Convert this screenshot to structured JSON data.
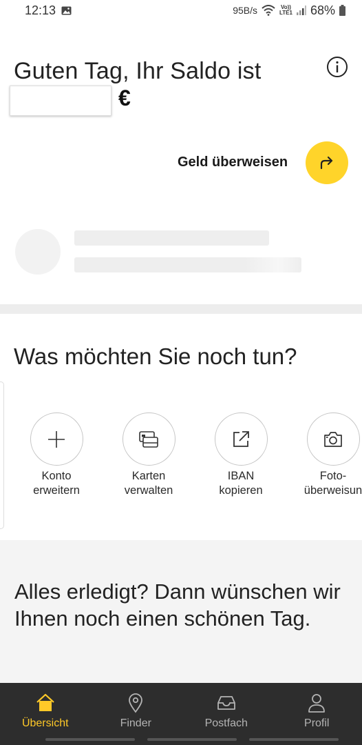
{
  "status_bar": {
    "time": "12:13",
    "network_speed": "95B/s",
    "lte_label_top": "Vo))",
    "lte_label_bottom": "LTE1",
    "battery": "68%"
  },
  "header": {
    "greeting": "Guten Tag, Ihr Saldo ist",
    "currency": "€",
    "info_icon": "info-icon"
  },
  "transfer": {
    "label": "Geld überweisen",
    "icon": "arrow-forward-icon",
    "accent": "#ffd42a"
  },
  "actions": {
    "title": "Was möchten Sie noch tun?",
    "items": [
      {
        "line1": "Konto",
        "line2": "erweitern",
        "icon": "plus-icon"
      },
      {
        "line1": "Karten",
        "line2": "verwalten",
        "icon": "cards-icon"
      },
      {
        "line1": "IBAN",
        "line2": "kopieren",
        "icon": "external-link-icon"
      },
      {
        "line1": "Foto-",
        "line2": "überweisun",
        "icon": "camera-icon"
      }
    ]
  },
  "farewell": {
    "text": "Alles erledigt? Dann wünschen wir Ihnen noch einen schönen Tag."
  },
  "bottom_nav": {
    "active_color": "#ffc928",
    "items": [
      {
        "label": "Übersicht",
        "icon": "home-icon",
        "active": true
      },
      {
        "label": "Finder",
        "icon": "map-pin-icon",
        "active": false
      },
      {
        "label": "Postfach",
        "icon": "inbox-icon",
        "active": false
      },
      {
        "label": "Profil",
        "icon": "person-icon",
        "active": false
      }
    ]
  }
}
